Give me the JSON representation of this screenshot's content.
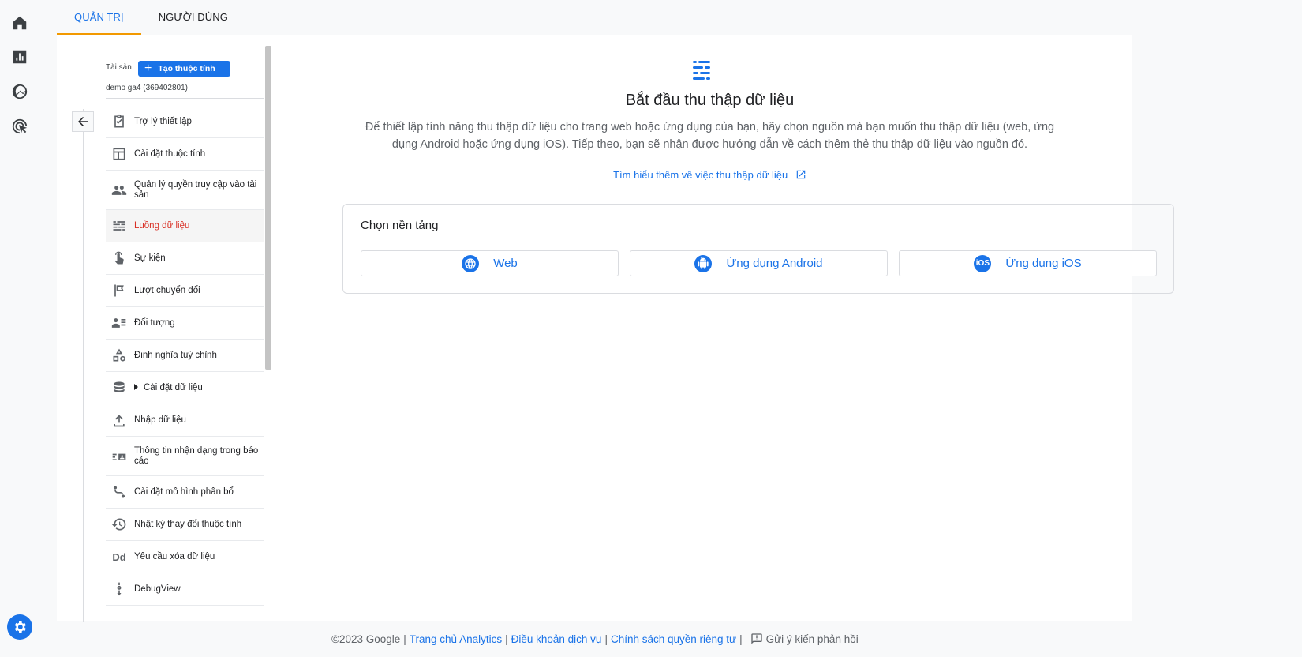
{
  "tabs": {
    "admin": "QUẢN TRỊ",
    "users": "NGƯỜI DÙNG"
  },
  "sidebar": {
    "property_label": "Tài sản",
    "create_button": "Tạo thuộc tính",
    "property_name": "demo ga4 (369402801)",
    "items": [
      {
        "label": "Trợ lý thiết lập",
        "icon": "checklist-icon"
      },
      {
        "label": "Cài đặt thuộc tính",
        "icon": "layout-icon"
      },
      {
        "label": "Quản lý quyền truy cập vào tài sản",
        "icon": "people-icon"
      },
      {
        "label": "Luồng dữ liệu",
        "icon": "data-stream-icon"
      },
      {
        "label": "Sự kiện",
        "icon": "touch-icon"
      },
      {
        "label": "Lượt chuyển đổi",
        "icon": "flag-icon"
      },
      {
        "label": "Đối tượng",
        "icon": "audience-icon"
      },
      {
        "label": "Định nghĩa tuỳ chỉnh",
        "icon": "shapes-icon"
      },
      {
        "label": "Cài đặt dữ liệu",
        "icon": "database-icon"
      },
      {
        "label": "Nhập dữ liệu",
        "icon": "upload-icon"
      },
      {
        "label": "Thông tin nhận dạng trong báo cáo",
        "icon": "id-card-icon"
      },
      {
        "label": "Cài đặt mô hình phân bổ",
        "icon": "route-icon"
      },
      {
        "label": "Nhật ký thay đổi thuộc tính",
        "icon": "history-icon"
      },
      {
        "label": "Yêu cầu xóa dữ liệu",
        "icon": "dd-icon",
        "glyph": "Dd"
      },
      {
        "label": "DebugView",
        "icon": "debug-icon"
      }
    ]
  },
  "content": {
    "title": "Bắt đầu thu thập dữ liệu",
    "description": "Để thiết lập tính năng thu thập dữ liệu cho trang web hoặc ứng dụng của bạn, hãy chọn nguồn mà bạn muốn thu thập dữ liệu (web, ứng dụng Android hoặc ứng dụng iOS). Tiếp theo, bạn sẽ nhận được hướng dẫn về cách thêm thẻ thu thập dữ liệu vào nguồn đó.",
    "learn_more": "Tìm hiểu thêm về việc thu thập dữ liệu",
    "platform_title": "Chọn nền tảng",
    "platforms": [
      {
        "label": "Web",
        "icon": "globe-icon"
      },
      {
        "label": "Ứng dụng Android",
        "icon": "android-icon"
      },
      {
        "label": "Ứng dụng iOS",
        "icon": "ios-icon",
        "glyph": "iOS"
      }
    ]
  },
  "footer": {
    "copyright": "©2023 Google",
    "link_home": "Trang chủ Analytics",
    "link_terms": "Điều khoản dịch vụ",
    "link_privacy": "Chính sách quyền riêng tư",
    "feedback": "Gửi ý kiến phản hồi"
  },
  "colors": {
    "accent": "#1a73e8",
    "active_item": "#d93025",
    "tab_indicator": "#f29900"
  }
}
